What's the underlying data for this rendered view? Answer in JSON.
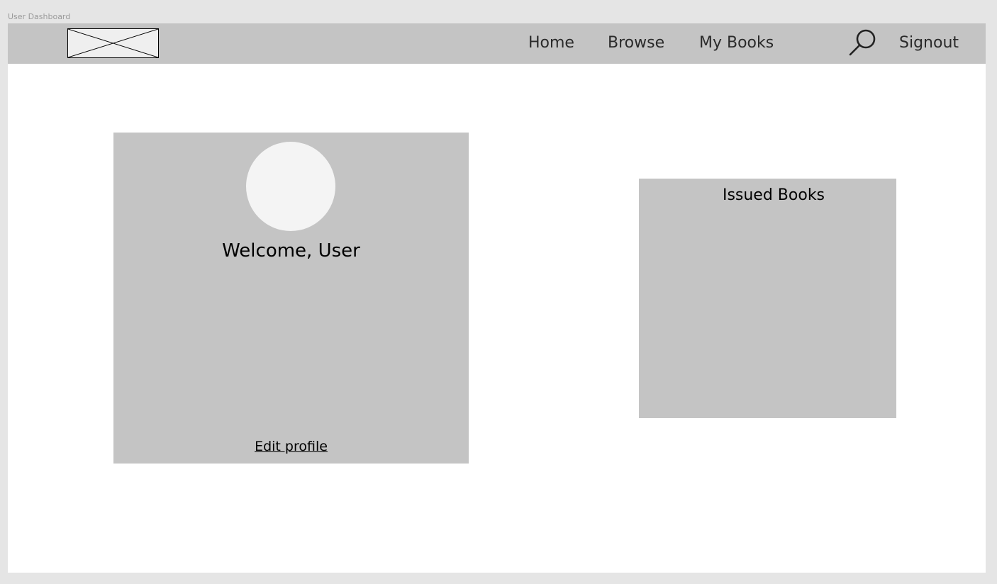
{
  "frame": {
    "label": "User Dashboard"
  },
  "nav": {
    "links": [
      "Home",
      "Browse",
      "My Books"
    ],
    "signout": "Signout",
    "search_icon": "search-icon",
    "logo_icon": "image-placeholder-icon"
  },
  "profile": {
    "welcome": "Welcome, User",
    "edit_label": "Edit profile"
  },
  "issued": {
    "title": "Issued Books"
  },
  "colors": {
    "background": "#e5e5e5",
    "frame": "#ffffff",
    "panel": "#c4c4c4",
    "avatar": "#f4f4f4",
    "text": "#000000"
  }
}
